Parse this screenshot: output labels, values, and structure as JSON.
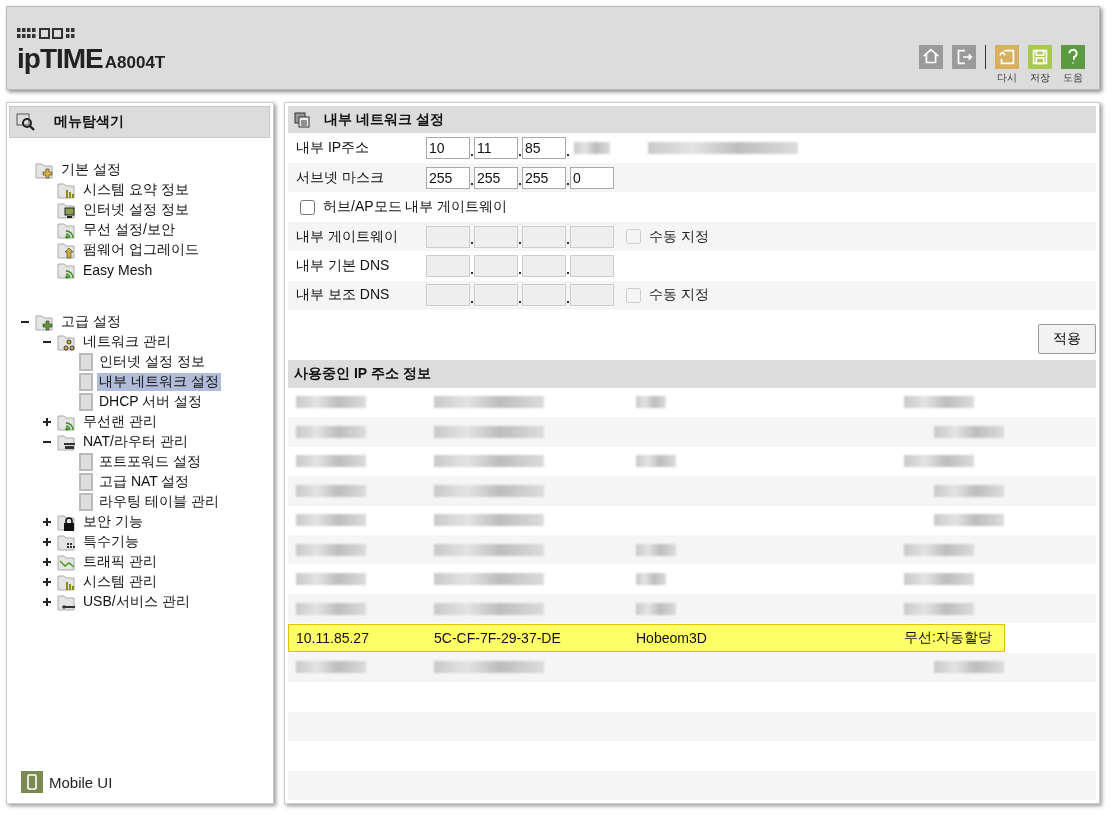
{
  "header": {
    "brand": "ipTIME",
    "model": "A8004T",
    "tools": [
      {
        "kind": "home"
      },
      {
        "kind": "logout"
      },
      {
        "kind": "reload",
        "label": "다시"
      },
      {
        "kind": "save",
        "label": "저장"
      },
      {
        "kind": "help",
        "label": "도움"
      }
    ]
  },
  "sidebar": {
    "title": "메뉴탐색기",
    "footer": "Mobile UI",
    "tree": [
      {
        "label": "기본 설정",
        "children": [
          {
            "label": "시스템 요약 정보",
            "selected": false
          },
          {
            "label": "인터넷 설정 정보",
            "selected": false
          },
          {
            "label": "무선 설정/보안",
            "selected": false
          },
          {
            "label": "펌웨어 업그레이드",
            "selected": false
          },
          {
            "label": "Easy Mesh",
            "selected": false
          }
        ]
      },
      {
        "label": "고급 설정",
        "expanded": true,
        "children": [
          {
            "label": "네트워크 관리",
            "expanded": true,
            "children": [
              {
                "label": "인터넷 설정 정보",
                "selected": false
              },
              {
                "label": "내부 네트워크 설정",
                "selected": true
              },
              {
                "label": "DHCP 서버 설정",
                "selected": false
              }
            ]
          },
          {
            "label": "무선랜 관리",
            "expanded": false
          },
          {
            "label": "NAT/라우터 관리",
            "expanded": true,
            "children": [
              {
                "label": "포트포워드 설정",
                "selected": false
              },
              {
                "label": "고급 NAT 설정",
                "selected": false
              },
              {
                "label": "라우팅 테이블 관리",
                "selected": false
              }
            ]
          },
          {
            "label": "보안 기능",
            "expanded": false
          },
          {
            "label": "특수기능",
            "expanded": false
          },
          {
            "label": "트래픽 관리",
            "expanded": false
          },
          {
            "label": "시스템 관리",
            "expanded": false
          },
          {
            "label": "USB/서비스 관리",
            "expanded": false
          }
        ]
      }
    ]
  },
  "settings": {
    "title": "내부 네트워크 설정",
    "rows": [
      {
        "kind": "address",
        "label": "내부 IP주소",
        "octets": [
          "10",
          "11",
          "85"
        ],
        "redacted": true
      },
      {
        "kind": "address",
        "label": "서브넷 마스크",
        "octets": [
          "255",
          "255",
          "255",
          "0"
        ]
      },
      {
        "kind": "checkbox",
        "label": "허브/AP모드 내부 게이트웨이",
        "checked": false
      },
      {
        "kind": "address",
        "label": "내부 게이트웨이",
        "disabled": true,
        "manual": {
          "label": "수동 지정",
          "checked": false,
          "disabled": true
        }
      },
      {
        "kind": "address",
        "label": "내부 기본 DNS",
        "disabled": true
      },
      {
        "kind": "address",
        "label": "내부 보조 DNS",
        "disabled": true,
        "manual": {
          "label": "수동 지정",
          "checked": false,
          "disabled": true
        }
      }
    ],
    "apply": "적용"
  },
  "leases": {
    "title": "사용중인 IP 주소 정보",
    "rows": [
      {
        "kind": "redacted",
        "cells": [
          true,
          true,
          true,
          true
        ],
        "selected": false
      },
      {
        "kind": "redacted",
        "cells": [
          true,
          true,
          false,
          true
        ],
        "selected": false
      },
      {
        "kind": "redacted",
        "cells": [
          true,
          true,
          true,
          true
        ],
        "selected": false
      },
      {
        "kind": "redacted",
        "cells": [
          true,
          true,
          false,
          true
        ],
        "selected": false
      },
      {
        "kind": "redacted",
        "cells": [
          true,
          true,
          false,
          true
        ],
        "selected": false
      },
      {
        "kind": "redacted",
        "cells": [
          true,
          true,
          true,
          true
        ],
        "selected": false
      },
      {
        "kind": "redacted",
        "cells": [
          true,
          true,
          true,
          true
        ],
        "selected": false
      },
      {
        "kind": "redacted",
        "cells": [
          true,
          true,
          true,
          true
        ],
        "selected": false
      },
      {
        "kind": "plain",
        "cells": [
          "10.11.85.27",
          "5C-CF-7F-29-37-DE",
          "Hobeom3D",
          "무선:자동할당"
        ],
        "selected": true
      },
      {
        "kind": "redacted",
        "cells": [
          true,
          true,
          false,
          true
        ],
        "selected": false
      }
    ]
  }
}
